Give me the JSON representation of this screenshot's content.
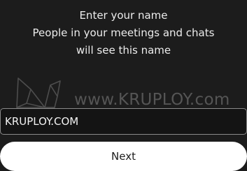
{
  "prompt": {
    "title": "Enter your name",
    "line2": "People in your meetings and chats",
    "line3": "will see this name"
  },
  "watermark": {
    "text": "www.KRUPLOY.com",
    "logo_icon": "origami-swan-icon"
  },
  "name_field": {
    "value": "KRUPLOY.COM"
  },
  "actions": {
    "next_label": "Next"
  },
  "colors": {
    "background": "#1c1c1c",
    "text": "#ececec",
    "button_bg": "#ffffff",
    "button_text": "#1c1c1c",
    "input_border": "#8a8a8a",
    "watermark": "#555555"
  }
}
